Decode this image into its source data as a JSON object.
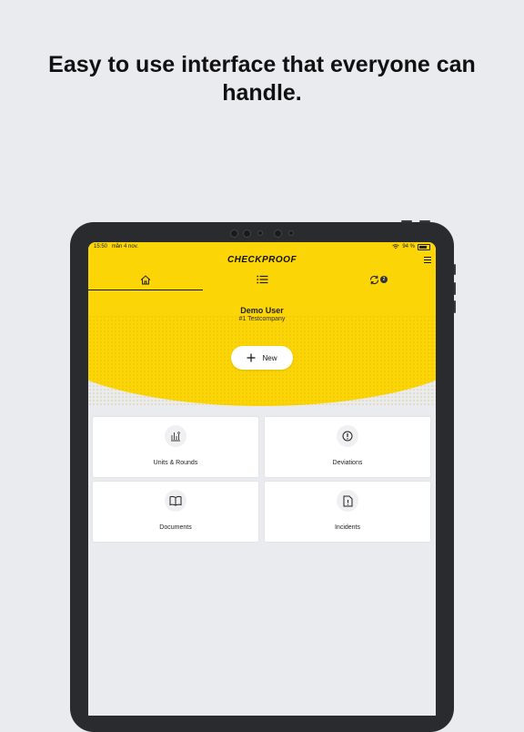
{
  "headline": [
    "Easy to use interface that everyone can",
    "handle."
  ],
  "status_bar": {
    "time": "15:50",
    "date": "mån 4 nov.",
    "battery": "94 %"
  },
  "app": {
    "logo": "CHECKPROOF",
    "sync_badge": "2"
  },
  "tabs": [
    {
      "icon": "home-icon",
      "active": true
    },
    {
      "icon": "list-icon",
      "active": false
    },
    {
      "icon": "sync-icon",
      "active": false
    }
  ],
  "user": {
    "name": "Demo User",
    "company": "#1 Testcompany"
  },
  "new_button": {
    "label": "New"
  },
  "cards": [
    {
      "label": "Units & Rounds",
      "icon": "rounds-icon"
    },
    {
      "label": "Deviations",
      "icon": "alert-icon"
    },
    {
      "label": "Documents",
      "icon": "book-icon"
    },
    {
      "label": "Incidents",
      "icon": "incident-icon"
    }
  ],
  "colors": {
    "brand_yellow": "#fbd506",
    "background": "#eaebef",
    "frame": "#2a2b2e"
  }
}
